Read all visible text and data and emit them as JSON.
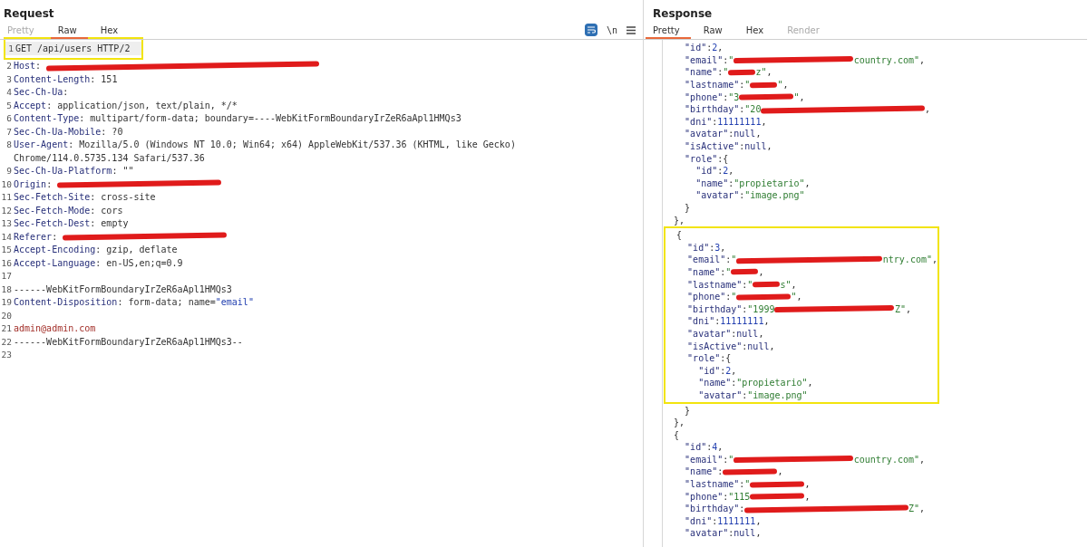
{
  "request": {
    "title": "Request",
    "tabs": [
      {
        "label": "Pretty",
        "selected": false,
        "disabled": true
      },
      {
        "label": "Raw",
        "selected": true,
        "disabled": false
      },
      {
        "label": "Hex",
        "selected": false,
        "disabled": false
      }
    ],
    "toolbar": [
      {
        "kind": "wrap",
        "selected": true
      },
      {
        "kind": "newline",
        "label": "\\n"
      },
      {
        "kind": "menu"
      }
    ],
    "lines": [
      {
        "kind": "box",
        "lines": [
          {
            "number": "1",
            "current": true,
            "parts": [
              {
                "kind": "plain",
                "text": "GET /api/users HTTP/2"
              }
            ]
          }
        ]
      },
      {
        "number": "2",
        "parts": [
          {
            "kind": "name",
            "text": "Host"
          },
          {
            "kind": "plain",
            "text": ": "
          },
          {
            "kind": "redacted-widest"
          }
        ]
      },
      {
        "number": "3",
        "parts": [
          {
            "kind": "name",
            "text": "Content-Length"
          },
          {
            "kind": "plain",
            "text": ": 151"
          }
        ]
      },
      {
        "number": "4",
        "parts": [
          {
            "kind": "name",
            "text": "Sec-Ch-Ua"
          },
          {
            "kind": "plain",
            "text": ":"
          }
        ]
      },
      {
        "number": "5",
        "parts": [
          {
            "kind": "name",
            "text": "Accept"
          },
          {
            "kind": "plain",
            "text": ": application/json, text/plain, */*"
          }
        ]
      },
      {
        "number": "6",
        "parts": [
          {
            "kind": "name",
            "text": "Content-Type"
          },
          {
            "kind": "plain",
            "text": ": multipart/form-data; boundary=----WebKitFormBoundaryIrZeR6aApl1HMQs3"
          }
        ]
      },
      {
        "number": "7",
        "parts": [
          {
            "kind": "name",
            "text": "Sec-Ch-Ua-Mobile"
          },
          {
            "kind": "plain",
            "text": ": ?0"
          }
        ]
      },
      {
        "number": "8",
        "parts": [
          {
            "kind": "name",
            "text": "User-Agent"
          },
          {
            "kind": "plain",
            "text": ": Mozilla/5.0 (Windows NT 10.0; Win64; x64) AppleWebKit/537.36 (KHTML, like Gecko)"
          }
        ]
      },
      {
        "parts": [
          {
            "kind": "plain",
            "text": "Chrome/114.0.5735.134 Safari/537.36"
          }
        ]
      },
      {
        "number": "9",
        "parts": [
          {
            "kind": "name",
            "text": "Sec-Ch-Ua-Platform"
          },
          {
            "kind": "plain",
            "text": ": \"\""
          }
        ]
      },
      {
        "number": "10",
        "parts": [
          {
            "kind": "name",
            "text": "Origin"
          },
          {
            "kind": "plain",
            "text": ": "
          },
          {
            "kind": "redacted-wide"
          }
        ]
      },
      {
        "number": "11",
        "parts": [
          {
            "kind": "name",
            "text": "Sec-Fetch-Site"
          },
          {
            "kind": "plain",
            "text": ": cross-site"
          }
        ]
      },
      {
        "number": "12",
        "parts": [
          {
            "kind": "name",
            "text": "Sec-Fetch-Mode"
          },
          {
            "kind": "plain",
            "text": ": cors"
          }
        ]
      },
      {
        "number": "13",
        "parts": [
          {
            "kind": "name",
            "text": "Sec-Fetch-Dest"
          },
          {
            "kind": "plain",
            "text": ": empty"
          }
        ]
      },
      {
        "number": "14",
        "parts": [
          {
            "kind": "name",
            "text": "Referer"
          },
          {
            "kind": "plain",
            "text": ": "
          },
          {
            "kind": "redacted-wide"
          }
        ]
      },
      {
        "number": "15",
        "parts": [
          {
            "kind": "name",
            "text": "Accept-Encoding"
          },
          {
            "kind": "plain",
            "text": ": gzip, deflate"
          }
        ]
      },
      {
        "number": "16",
        "parts": [
          {
            "kind": "name",
            "text": "Accept-Language"
          },
          {
            "kind": "plain",
            "text": ": en-US,en;q=0.9"
          }
        ]
      },
      {
        "number": "17"
      },
      {
        "number": "18",
        "parts": [
          {
            "kind": "plain",
            "text": "------WebKitFormBoundaryIrZeR6aApl1HMQs3"
          }
        ]
      },
      {
        "number": "19",
        "parts": [
          {
            "kind": "name",
            "text": "Content-Disposition"
          },
          {
            "kind": "plain",
            "text": ": form-data; name="
          },
          {
            "kind": "value",
            "text": "\"email\""
          }
        ]
      },
      {
        "number": "20"
      },
      {
        "number": "21",
        "parts": [
          {
            "kind": "body",
            "text": "admin@admin.com"
          }
        ]
      },
      {
        "number": "22",
        "parts": [
          {
            "kind": "plain",
            "text": "------WebKitFormBoundaryIrZeR6aApl1HMQs3--"
          }
        ]
      },
      {
        "number": "23"
      }
    ]
  },
  "response": {
    "title": "Response",
    "tabs": [
      {
        "label": "Pretty",
        "selected": true,
        "disabled": false
      },
      {
        "label": "Raw",
        "selected": false,
        "disabled": false
      },
      {
        "label": "Hex",
        "selected": false,
        "disabled": false
      },
      {
        "label": "Render",
        "selected": false,
        "disabled": true
      }
    ],
    "lines": [
      {
        "parts": [
          {
            "kind": "key",
            "text": "    \"id\""
          },
          {
            "kind": "plain",
            "text": ":"
          },
          {
            "kind": "num",
            "text": "2"
          },
          {
            "kind": "plain",
            "text": ","
          }
        ]
      },
      {
        "parts": [
          {
            "kind": "key",
            "text": "    \"email\""
          },
          {
            "kind": "plain",
            "text": ":"
          },
          {
            "kind": "str",
            "text": "\""
          },
          {
            "kind": "redacted-long"
          },
          {
            "kind": "str",
            "text": "country.com\""
          },
          {
            "kind": "plain",
            "text": ","
          }
        ]
      },
      {
        "parts": [
          {
            "kind": "key",
            "text": "    \"name\""
          },
          {
            "kind": "plain",
            "text": ":"
          },
          {
            "kind": "str",
            "text": "\""
          },
          {
            "kind": "redacted-short"
          },
          {
            "kind": "str",
            "text": "z\""
          },
          {
            "kind": "plain",
            "text": ","
          }
        ]
      },
      {
        "parts": [
          {
            "kind": "key",
            "text": "    \"lastname\""
          },
          {
            "kind": "plain",
            "text": ":"
          },
          {
            "kind": "str",
            "text": "\""
          },
          {
            "kind": "redacted-short"
          },
          {
            "kind": "str",
            "text": "\""
          },
          {
            "kind": "plain",
            "text": ","
          }
        ]
      },
      {
        "parts": [
          {
            "kind": "key",
            "text": "    \"phone\""
          },
          {
            "kind": "plain",
            "text": ":"
          },
          {
            "kind": "str",
            "text": "\"3"
          },
          {
            "kind": "redacted-medium"
          },
          {
            "kind": "str",
            "text": "\""
          },
          {
            "kind": "plain",
            "text": ","
          }
        ]
      },
      {
        "parts": [
          {
            "kind": "key",
            "text": "    \"birthday\""
          },
          {
            "kind": "plain",
            "text": ":"
          },
          {
            "kind": "str",
            "text": "\"20"
          },
          {
            "kind": "redacted-wide"
          },
          {
            "kind": "plain",
            "text": ","
          }
        ]
      },
      {
        "parts": [
          {
            "kind": "key",
            "text": "    \"dni\""
          },
          {
            "kind": "plain",
            "text": ":"
          },
          {
            "kind": "num",
            "text": "11111111"
          },
          {
            "kind": "plain",
            "text": ","
          }
        ]
      },
      {
        "parts": [
          {
            "kind": "key",
            "text": "    \"avatar\""
          },
          {
            "kind": "plain",
            "text": ":"
          },
          {
            "kind": "lit",
            "text": "null"
          },
          {
            "kind": "plain",
            "text": ","
          }
        ]
      },
      {
        "parts": [
          {
            "kind": "key",
            "text": "    \"isActive\""
          },
          {
            "kind": "plain",
            "text": ":"
          },
          {
            "kind": "lit",
            "text": "null"
          },
          {
            "kind": "plain",
            "text": ","
          }
        ]
      },
      {
        "parts": [
          {
            "kind": "key",
            "text": "    \"role\""
          },
          {
            "kind": "plain",
            "text": ":{"
          }
        ]
      },
      {
        "parts": [
          {
            "kind": "key",
            "text": "      \"id\""
          },
          {
            "kind": "plain",
            "text": ":"
          },
          {
            "kind": "num",
            "text": "2"
          },
          {
            "kind": "plain",
            "text": ","
          }
        ]
      },
      {
        "parts": [
          {
            "kind": "key",
            "text": "      \"name\""
          },
          {
            "kind": "plain",
            "text": ":"
          },
          {
            "kind": "str",
            "text": "\"propietario\""
          },
          {
            "kind": "plain",
            "text": ","
          }
        ]
      },
      {
        "parts": [
          {
            "kind": "key",
            "text": "      \"avatar\""
          },
          {
            "kind": "plain",
            "text": ":"
          },
          {
            "kind": "str",
            "text": "\"image.png\""
          }
        ]
      },
      {
        "parts": [
          {
            "kind": "plain",
            "text": "    }"
          }
        ]
      },
      {
        "parts": [
          {
            "kind": "plain",
            "text": "  },"
          }
        ]
      },
      {
        "kind": "box",
        "lines": [
          {
            "parts": [
              {
                "kind": "plain",
                "text": "  {"
              }
            ]
          },
          {
            "parts": [
              {
                "kind": "key",
                "text": "    \"id\""
              },
              {
                "kind": "plain",
                "text": ":"
              },
              {
                "kind": "num",
                "text": "3"
              },
              {
                "kind": "plain",
                "text": ","
              }
            ]
          },
          {
            "parts": [
              {
                "kind": "key",
                "text": "    \"email\""
              },
              {
                "kind": "plain",
                "text": ":"
              },
              {
                "kind": "str",
                "text": "\""
              },
              {
                "kind": "redacted-wide"
              },
              {
                "kind": "str",
                "text": "ntry.com\""
              },
              {
                "kind": "plain",
                "text": ","
              }
            ]
          },
          {
            "parts": [
              {
                "kind": "key",
                "text": "    \"name\""
              },
              {
                "kind": "plain",
                "text": ":"
              },
              {
                "kind": "str",
                "text": "\""
              },
              {
                "kind": "redacted-short"
              },
              {
                "kind": "plain",
                "text": ","
              }
            ]
          },
          {
            "parts": [
              {
                "kind": "key",
                "text": "    \"lastname\""
              },
              {
                "kind": "plain",
                "text": ":"
              },
              {
                "kind": "str",
                "text": "\""
              },
              {
                "kind": "redacted-short"
              },
              {
                "kind": "str",
                "text": "s\""
              },
              {
                "kind": "plain",
                "text": ","
              }
            ]
          },
          {
            "parts": [
              {
                "kind": "key",
                "text": "    \"phone\""
              },
              {
                "kind": "plain",
                "text": ":"
              },
              {
                "kind": "str",
                "text": "\""
              },
              {
                "kind": "redacted-medium"
              },
              {
                "kind": "str",
                "text": "\""
              },
              {
                "kind": "plain",
                "text": ","
              }
            ]
          },
          {
            "parts": [
              {
                "kind": "key",
                "text": "    \"birthday\""
              },
              {
                "kind": "plain",
                "text": ":"
              },
              {
                "kind": "str",
                "text": "\"1999"
              },
              {
                "kind": "redacted-long"
              },
              {
                "kind": "str",
                "text": "Z\""
              },
              {
                "kind": "plain",
                "text": ","
              }
            ]
          },
          {
            "parts": [
              {
                "kind": "key",
                "text": "    \"dni\""
              },
              {
                "kind": "plain",
                "text": ":"
              },
              {
                "kind": "num",
                "text": "11111111"
              },
              {
                "kind": "plain",
                "text": ","
              }
            ]
          },
          {
            "parts": [
              {
                "kind": "key",
                "text": "    \"avatar\""
              },
              {
                "kind": "plain",
                "text": ":"
              },
              {
                "kind": "lit",
                "text": "null"
              },
              {
                "kind": "plain",
                "text": ","
              }
            ]
          },
          {
            "parts": [
              {
                "kind": "key",
                "text": "    \"isActive\""
              },
              {
                "kind": "plain",
                "text": ":"
              },
              {
                "kind": "lit",
                "text": "null"
              },
              {
                "kind": "plain",
                "text": ","
              }
            ]
          },
          {
            "parts": [
              {
                "kind": "key",
                "text": "    \"role\""
              },
              {
                "kind": "plain",
                "text": ":{"
              }
            ]
          },
          {
            "parts": [
              {
                "kind": "key",
                "text": "      \"id\""
              },
              {
                "kind": "plain",
                "text": ":"
              },
              {
                "kind": "num",
                "text": "2"
              },
              {
                "kind": "plain",
                "text": ","
              }
            ]
          },
          {
            "parts": [
              {
                "kind": "key",
                "text": "      \"name\""
              },
              {
                "kind": "plain",
                "text": ":"
              },
              {
                "kind": "str",
                "text": "\"propietario\""
              },
              {
                "kind": "plain",
                "text": ","
              }
            ]
          },
          {
            "parts": [
              {
                "kind": "key",
                "text": "      \"avatar\""
              },
              {
                "kind": "plain",
                "text": ":"
              },
              {
                "kind": "str",
                "text": "\"image.png\""
              }
            ]
          }
        ]
      },
      {
        "parts": [
          {
            "kind": "plain",
            "text": "    }"
          }
        ]
      },
      {
        "parts": [
          {
            "kind": "plain",
            "text": "  },"
          }
        ]
      },
      {
        "parts": [
          {
            "kind": "plain",
            "text": "  {"
          }
        ]
      },
      {
        "parts": [
          {
            "kind": "key",
            "text": "    \"id\""
          },
          {
            "kind": "plain",
            "text": ":"
          },
          {
            "kind": "num",
            "text": "4"
          },
          {
            "kind": "plain",
            "text": ","
          }
        ]
      },
      {
        "parts": [
          {
            "kind": "key",
            "text": "    \"email\""
          },
          {
            "kind": "plain",
            "text": ":"
          },
          {
            "kind": "str",
            "text": "\""
          },
          {
            "kind": "redacted-long"
          },
          {
            "kind": "str",
            "text": "country.com\""
          },
          {
            "kind": "plain",
            "text": ","
          }
        ]
      },
      {
        "parts": [
          {
            "kind": "key",
            "text": "    \"name\""
          },
          {
            "kind": "plain",
            "text": ":"
          },
          {
            "kind": "redacted-medium"
          },
          {
            "kind": "plain",
            "text": ","
          }
        ]
      },
      {
        "parts": [
          {
            "kind": "key",
            "text": "    \"lastname\""
          },
          {
            "kind": "plain",
            "text": ":"
          },
          {
            "kind": "str",
            "text": "\""
          },
          {
            "kind": "redacted-medium"
          },
          {
            "kind": "plain",
            "text": ","
          }
        ]
      },
      {
        "parts": [
          {
            "kind": "key",
            "text": "    \"phone\""
          },
          {
            "kind": "plain",
            "text": ":"
          },
          {
            "kind": "str",
            "text": "\"115"
          },
          {
            "kind": "redacted-medium"
          },
          {
            "kind": "plain",
            "text": ","
          }
        ]
      },
      {
        "parts": [
          {
            "kind": "key",
            "text": "    \"birthday\""
          },
          {
            "kind": "plain",
            "text": ":"
          },
          {
            "kind": "redacted-wide"
          },
          {
            "kind": "str",
            "text": "Z\""
          },
          {
            "kind": "plain",
            "text": ","
          }
        ]
      },
      {
        "parts": [
          {
            "kind": "key",
            "text": "    \"dni\""
          },
          {
            "kind": "plain",
            "text": ":"
          },
          {
            "kind": "num",
            "text": "1111111"
          },
          {
            "kind": "plain",
            "text": ","
          }
        ]
      },
      {
        "parts": [
          {
            "kind": "key",
            "text": "    \"avatar\""
          },
          {
            "kind": "plain",
            "text": ":"
          },
          {
            "kind": "lit",
            "text": "null"
          },
          {
            "kind": "plain",
            "text": ","
          }
        ]
      }
    ]
  }
}
